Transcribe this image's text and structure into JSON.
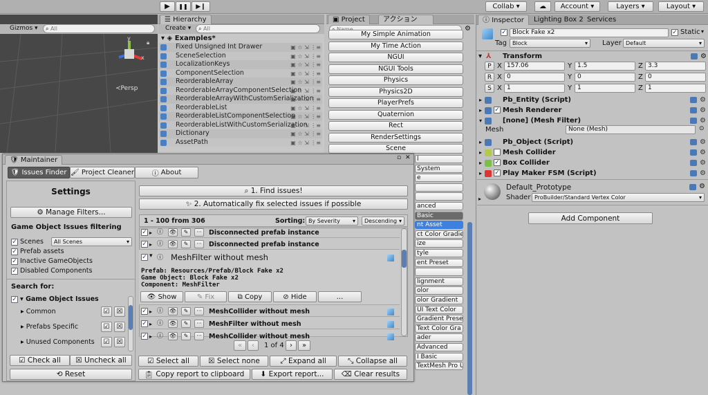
{
  "toolbar": {
    "play": "▶",
    "pause": "❚❚",
    "step": "▶❙",
    "collab": "Collab",
    "account": "Account",
    "layers": "Layers",
    "layout": "Layout"
  },
  "scene": {
    "gizmos": "Gizmos",
    "search_placeholder": "All",
    "persp": "Persp",
    "axis_y": "y",
    "axis_x": "x"
  },
  "hierarchy": {
    "tab": "Hierarchy",
    "create": "Create",
    "search_placeholder": "All",
    "root": "Examples*",
    "items": [
      "Fixed Unsigned Int Drawer",
      "SceneSelection",
      "LocalizationKeys",
      "ComponentSelection",
      "ReorderableArray",
      "ReorderableArrayComponentSelection",
      "ReorderableArrayWithCustomSerialization",
      "ReorderableList",
      "ReorderableListComponentSelection",
      "ReorderableListWithCustomSerialization",
      "Dictionary",
      "AssetPath"
    ]
  },
  "project": {
    "tab_project": "Project",
    "tab_action": "アクション",
    "search_placeholder": "Name",
    "buttons": [
      "My Simple Animation",
      "My Time Action",
      "NGUI",
      "NGUI Tools",
      "Physics",
      "Physics2D",
      "PlayerPrefs",
      "Quaternion",
      "Rect",
      "RenderSettings",
      "Scene"
    ],
    "partial": [
      "l",
      "System",
      "e",
      "",
      "",
      "anced",
      "Basic",
      "nt Asset",
      "ct Color Gradie",
      "ize",
      "tyle",
      "ent Preset",
      "",
      "lignment",
      "olor",
      "olor Gradient",
      "UI Text Color",
      "Gradient Prese",
      "Text Color Gra",
      "ader",
      "Advanced",
      "I Basic",
      "TextMesh Pro UGUI Shader"
    ]
  },
  "inspector": {
    "tab_inspector": "Inspector",
    "tab_lighting": "Lighting Box 2",
    "tab_services": "Services",
    "object_name": "Block Fake x2",
    "static": "Static",
    "tag_label": "Tag",
    "tag_value": "Block",
    "layer_label": "Layer",
    "layer_value": "Default",
    "transform": "Transform",
    "rows": [
      {
        "btn": "P",
        "x": "157.06",
        "y": "1.5",
        "z": "3.3"
      },
      {
        "btn": "R",
        "x": "0",
        "y": "0",
        "z": "0"
      },
      {
        "btn": "S",
        "x": "1",
        "y": "1",
        "z": "1"
      }
    ],
    "components": [
      "Pb_Entity (Script)",
      "Mesh Renderer",
      "[none] (Mesh Filter)",
      "Pb_Object (Script)",
      "Mesh Collider",
      "Box Collider",
      "Play Maker FSM (Script)"
    ],
    "mesh_label": "Mesh",
    "mesh_value": "None (Mesh)",
    "material_name": "Default_Prototype",
    "shader_label": "Shader",
    "shader_value": "ProBuilder/Standard Vertex Color",
    "add_component": "Add Component",
    "colors": {
      "accent": "#4b79b5",
      "selected": "#3d80df"
    }
  },
  "maintainer": {
    "title": "Maintainer",
    "tabs": [
      "Issues Finder",
      "Project Cleaner",
      "About"
    ],
    "settings_title": "Settings",
    "manage_filters": "Manage Filters...",
    "go_filter_title": "Game Object Issues filtering",
    "scenes_label": "Scenes",
    "scenes_value": "All Scenes",
    "options": [
      "Prefab assets",
      "Inactive GameObjects",
      "Disabled Components"
    ],
    "search_for": "Search for:",
    "go_issues": "Game Object Issues",
    "groups": [
      "Common",
      "Prefabs Specific",
      "Unused Components"
    ],
    "check_all": "Check all",
    "uncheck_all": "Uncheck all",
    "reset": "Reset",
    "find": "1. Find issues!",
    "autofix": "2. Automatically fix selected issues if possible",
    "range": "1 - 100 from 306",
    "sorting_label": "Sorting:",
    "sort_by": "By Severity",
    "sort_dir": "Descending",
    "issues": [
      "Disconnected prefab instance",
      "Disconnected prefab instance",
      "MeshFilter without mesh"
    ],
    "detail": {
      "prefab": "Prefab: Resources/Prefab/Block Fake x2",
      "game_object": "Game Object: Block Fake x2",
      "component": "Component: MeshFilter"
    },
    "detail_buttons": [
      "Show",
      "Fix",
      "Copy",
      "Hide",
      "..."
    ],
    "issues_after": [
      "MeshCollider without mesh",
      "MeshFilter without mesh",
      "MeshCollider without mesh"
    ],
    "pager": "1 of 4",
    "select_all": "Select all",
    "select_none": "Select none",
    "expand_all": "Expand all",
    "collapse_all": "Collapse all",
    "copy_report": "Copy report to clipboard",
    "export_report": "Export report...",
    "clear_results": "Clear results"
  }
}
